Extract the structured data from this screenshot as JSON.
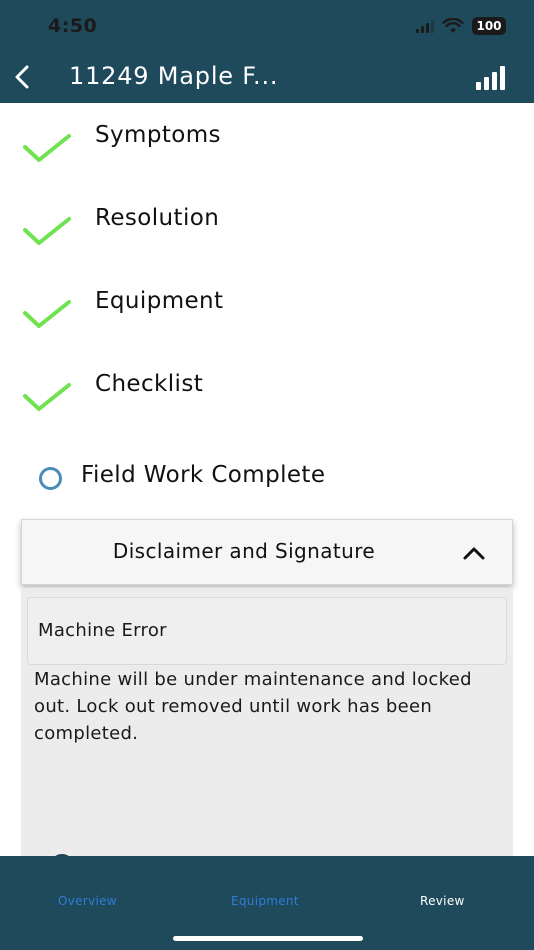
{
  "status_bar": {
    "time": "4:50",
    "battery": "100",
    "icons": [
      "cellular-signal-icon",
      "wifi-icon",
      "battery-icon"
    ]
  },
  "nav": {
    "back_icon": "chevron-left-icon",
    "title": "11249 Maple F...",
    "menu_icon": "signal-bars-icon"
  },
  "steps": [
    {
      "label": "Symptoms",
      "status": "complete"
    },
    {
      "label": "Resolution",
      "status": "complete"
    },
    {
      "label": "Equipment",
      "status": "complete"
    },
    {
      "label": "Checklist",
      "status": "complete"
    },
    {
      "label": "Field Work Complete",
      "status": "pending"
    }
  ],
  "accordion": {
    "title": "Disclaimer and Signature",
    "expanded": true,
    "reason": "Machine Error",
    "disclaimer": "Machine will be under maintenance and locked out. Lock out removed until work has been completed."
  },
  "tabs": [
    {
      "label": "Overview"
    },
    {
      "label": "Equipment"
    },
    {
      "label": "Review",
      "active": true
    }
  ],
  "colors": {
    "header_bg": "#1f4a5c",
    "check_green": "#6fe34f",
    "radio_blue": "#4a8cb8",
    "tab_blue": "#2e7cd6"
  }
}
